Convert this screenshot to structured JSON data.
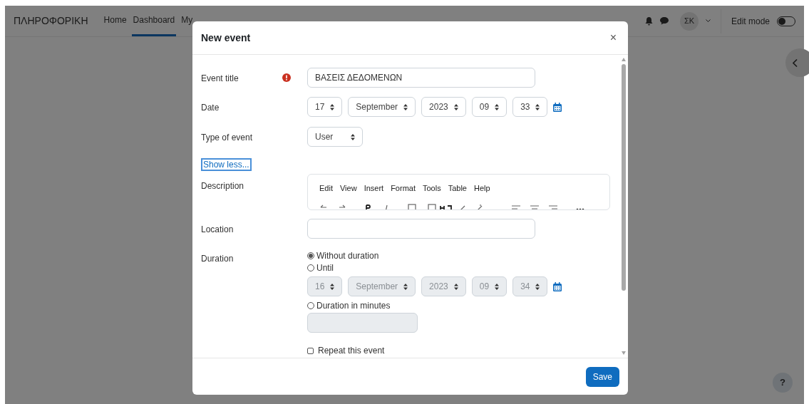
{
  "navbar": {
    "brand": "ΠΛΗΡΟΦΟΡΙΚΗ",
    "items": [
      {
        "label": "Home",
        "selected": false
      },
      {
        "label": "Dashboard",
        "selected": true
      },
      {
        "label": "My",
        "selected": false
      }
    ],
    "avatar": "ΣΚ",
    "edit_mode": {
      "label": "Edit mode",
      "on": false
    }
  },
  "help_button": "?",
  "dialog": {
    "title": "New event",
    "close": "×",
    "event_title": {
      "label": "Event title",
      "value": "ΒΑΣΕΙΣ ΔΕΔΟΜΕΝΩΝ",
      "required": true
    },
    "date": {
      "label": "Date",
      "selects": [
        {
          "value": "17",
          "disabled": false
        },
        {
          "value": "September",
          "disabled": false
        },
        {
          "value": "2023",
          "disabled": false
        },
        {
          "value": "09",
          "disabled": false
        },
        {
          "value": "33",
          "disabled": false
        }
      ]
    },
    "type_of_event": {
      "label": "Type of event",
      "value": "User"
    },
    "show_less": "Show less...",
    "description": {
      "label": "Description",
      "menu": [
        "Edit",
        "View",
        "Insert",
        "Format",
        "Tools",
        "Table",
        "Help"
      ]
    },
    "location": {
      "label": "Location"
    },
    "duration": {
      "label": "Duration",
      "options": [
        {
          "label": "Without duration",
          "selected": true
        },
        {
          "label": "Until",
          "selected": false
        },
        {
          "label": "Duration in minutes",
          "selected": false
        }
      ],
      "until_selects": [
        {
          "value": "16",
          "disabled": true
        },
        {
          "value": "September",
          "disabled": true
        },
        {
          "value": "2023",
          "disabled": true
        },
        {
          "value": "09",
          "disabled": true
        },
        {
          "value": "34",
          "disabled": true
        }
      ],
      "minutes_disabled": true
    },
    "repeat": {
      "label": "Repeat this event",
      "checked": false
    },
    "save": "Save"
  }
}
